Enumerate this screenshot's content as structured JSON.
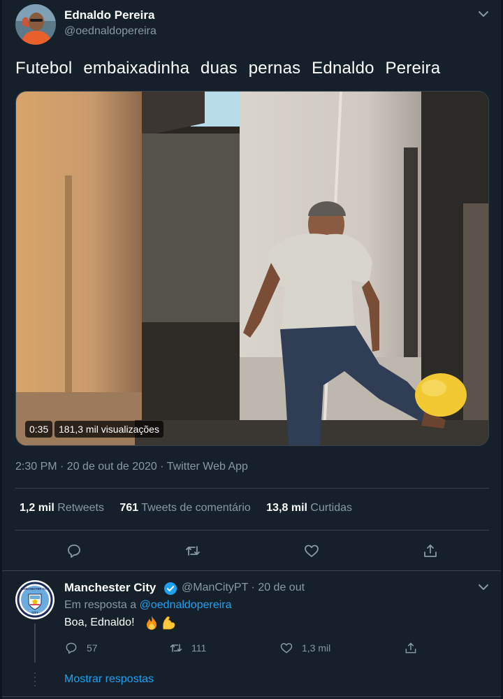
{
  "tweet": {
    "author_name": "Ednaldo Pereira",
    "author_handle": "@oednaldopereira",
    "text": "Futebol  embaixadinha  duas  pernas  Ednaldo Pereira",
    "video": {
      "duration": "0:35",
      "views": "181,3 mil visualizações"
    },
    "timestamp": "2:30 PM · 20 de out de 2020 · Twitter Web App",
    "stats": {
      "retweets_value": "1,2 mil",
      "retweets_label": "Retweets",
      "comments_value": "761",
      "comments_label": "Tweets de comentário",
      "likes_value": "13,8 mil",
      "likes_label": "Curtidas"
    },
    "icons": [
      "reply-icon",
      "retweet-icon",
      "like-icon",
      "share-icon",
      "chevron-down-icon"
    ]
  },
  "reply": {
    "author_name": "Manchester City",
    "author_handle": "@ManCityPT",
    "separator": "·",
    "date": "20 de out",
    "reply_prefix": "Em resposta a",
    "reply_to": "@oednaldopereira",
    "text": "Boa, Ednaldo!",
    "emojis": [
      "fire",
      "flexed-biceps"
    ],
    "replies_count": "57",
    "retweets_count": "111",
    "likes_count": "1,3 mil",
    "show_replies_label": "Mostrar respostas",
    "avatar_crest_label": "MANCHESTER CITY",
    "avatar_crest_sub": "CITY"
  },
  "colors": {
    "background": "#15202b",
    "border": "#38444d",
    "muted_text": "#8899a6",
    "accent": "#1da1f2",
    "verified": "#1da1f2"
  }
}
